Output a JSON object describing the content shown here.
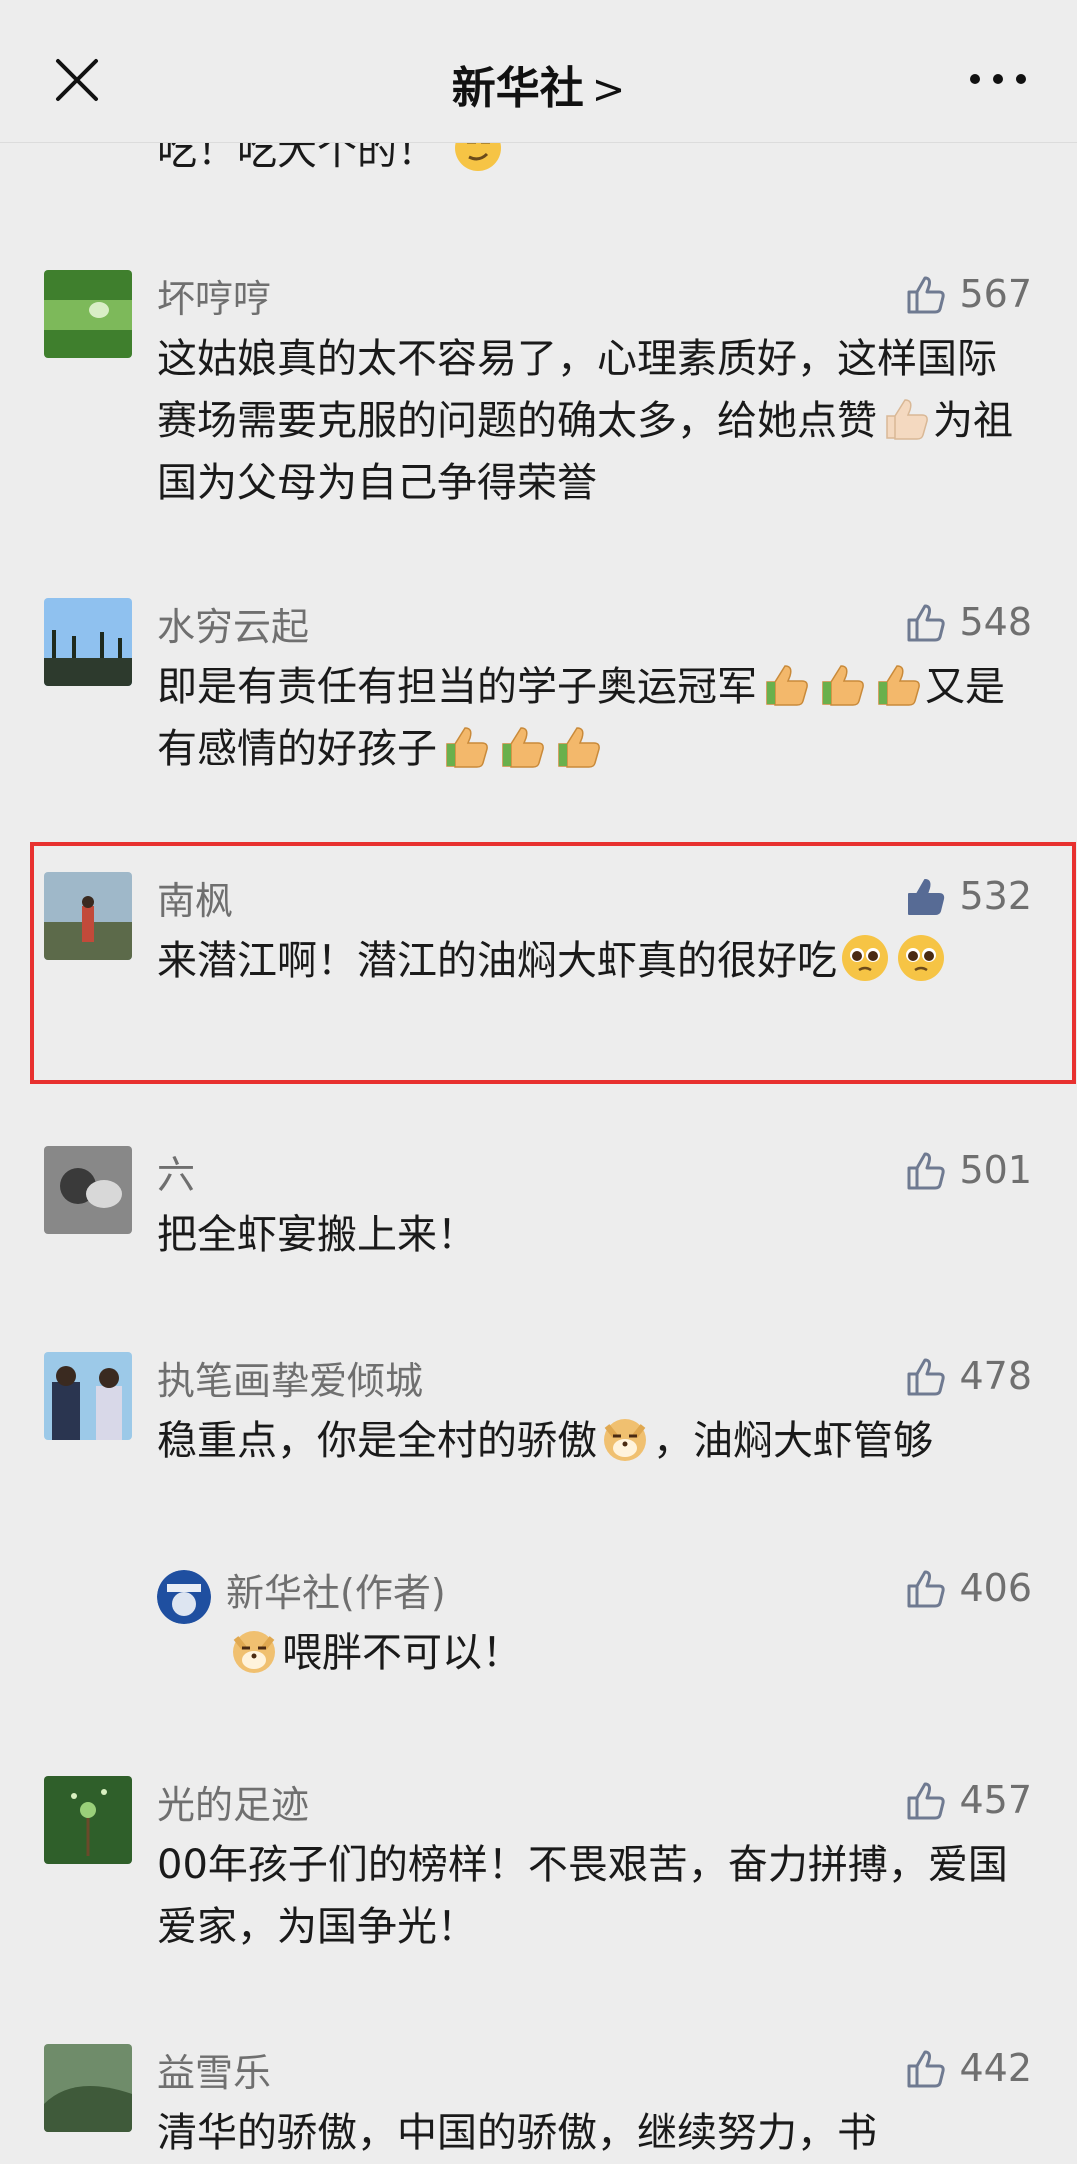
{
  "header": {
    "title": "新华社",
    "chevron": ">"
  },
  "icons": {
    "close": "close-icon",
    "more": "more-icon",
    "thumb": "thumbs-up-icon"
  },
  "top_partial": {
    "text": "吃！吃大个的！"
  },
  "comments": [
    {
      "name": "坏哼哼",
      "likes": "567",
      "text_parts": [
        "这姑娘真的太不容易了，心理素质好，这样国际赛场需要克服的问题的确太多，给她点赞",
        "为祖国为父母为自己争得荣誉"
      ],
      "emojis": [
        "thumbs-up-emoji"
      ]
    },
    {
      "name": "水穷云起",
      "likes": "548",
      "text_parts": [
        "即是有责任有担当的学子奥运冠军",
        "又是有感情的好孩子"
      ],
      "emojis": [
        "thumbs-up-emoji"
      ]
    },
    {
      "name": "南枫",
      "likes": "532",
      "liked": true,
      "text_parts": [
        "来潜江啊！潜江的油焖大虾真的很好吃"
      ],
      "emojis": [
        "pleading-face-emoji"
      ]
    },
    {
      "name": "六",
      "likes": "501",
      "text_parts": [
        "把全虾宴搬上来！"
      ]
    },
    {
      "name": "执笔画挚爱倾城",
      "likes": "478",
      "text_parts": [
        "稳重点，你是全村的骄傲",
        "，油焖大虾管够"
      ],
      "emojis": [
        "doge-emoji"
      ]
    },
    {
      "name": "新华社(作者)",
      "likes": "406",
      "reply": true,
      "text_parts": [
        "喂胖不可以！"
      ],
      "emojis": [
        "doge-emoji"
      ]
    },
    {
      "name": "光的足迹",
      "likes": "457",
      "text_parts": [
        "00年孩子们的榜样！不畏艰苦，奋力拼搏，爱国爱家，为国争光！"
      ]
    },
    {
      "name": "益雪乐",
      "likes": "442",
      "text_parts": [
        "清华的骄傲，中国的骄傲，继续努力，书"
      ]
    }
  ]
}
